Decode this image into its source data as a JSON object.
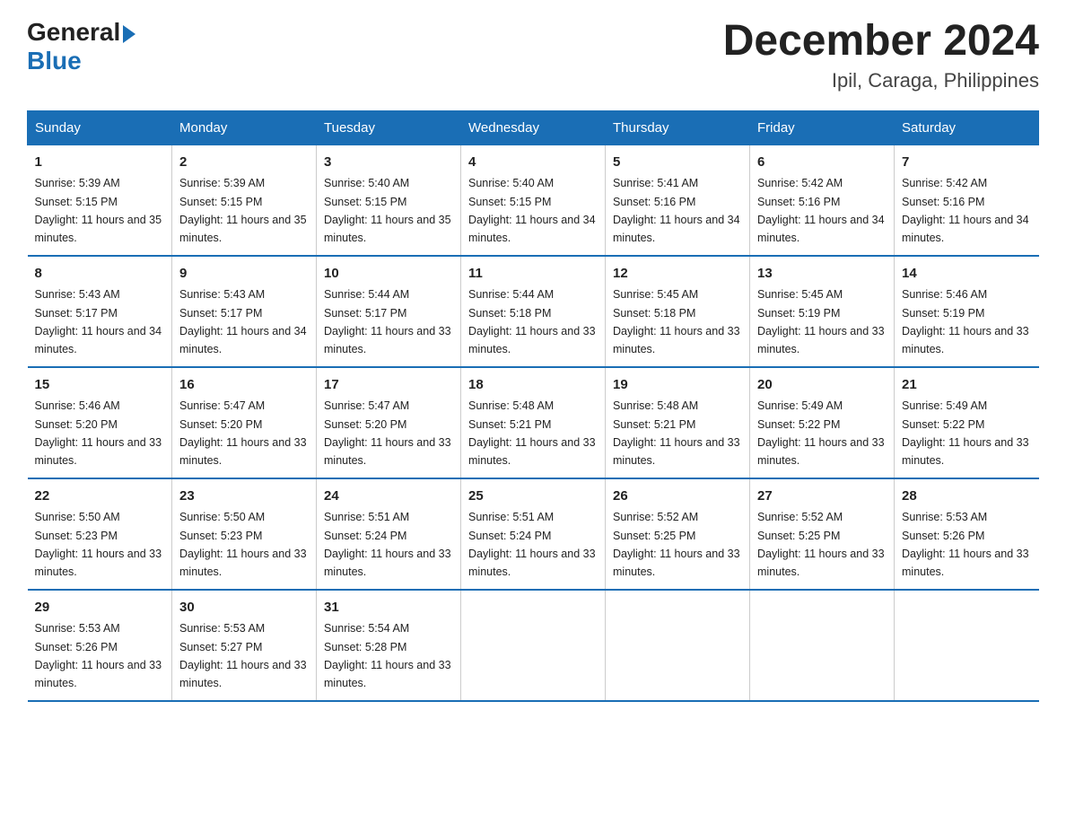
{
  "header": {
    "logo_general": "General",
    "logo_blue": "Blue",
    "title": "December 2024",
    "subtitle": "Ipil, Caraga, Philippines"
  },
  "days_of_week": [
    "Sunday",
    "Monday",
    "Tuesday",
    "Wednesday",
    "Thursday",
    "Friday",
    "Saturday"
  ],
  "weeks": [
    [
      {
        "day": "1",
        "sunrise": "5:39 AM",
        "sunset": "5:15 PM",
        "daylight": "11 hours and 35 minutes."
      },
      {
        "day": "2",
        "sunrise": "5:39 AM",
        "sunset": "5:15 PM",
        "daylight": "11 hours and 35 minutes."
      },
      {
        "day": "3",
        "sunrise": "5:40 AM",
        "sunset": "5:15 PM",
        "daylight": "11 hours and 35 minutes."
      },
      {
        "day": "4",
        "sunrise": "5:40 AM",
        "sunset": "5:15 PM",
        "daylight": "11 hours and 34 minutes."
      },
      {
        "day": "5",
        "sunrise": "5:41 AM",
        "sunset": "5:16 PM",
        "daylight": "11 hours and 34 minutes."
      },
      {
        "day": "6",
        "sunrise": "5:42 AM",
        "sunset": "5:16 PM",
        "daylight": "11 hours and 34 minutes."
      },
      {
        "day": "7",
        "sunrise": "5:42 AM",
        "sunset": "5:16 PM",
        "daylight": "11 hours and 34 minutes."
      }
    ],
    [
      {
        "day": "8",
        "sunrise": "5:43 AM",
        "sunset": "5:17 PM",
        "daylight": "11 hours and 34 minutes."
      },
      {
        "day": "9",
        "sunrise": "5:43 AM",
        "sunset": "5:17 PM",
        "daylight": "11 hours and 34 minutes."
      },
      {
        "day": "10",
        "sunrise": "5:44 AM",
        "sunset": "5:17 PM",
        "daylight": "11 hours and 33 minutes."
      },
      {
        "day": "11",
        "sunrise": "5:44 AM",
        "sunset": "5:18 PM",
        "daylight": "11 hours and 33 minutes."
      },
      {
        "day": "12",
        "sunrise": "5:45 AM",
        "sunset": "5:18 PM",
        "daylight": "11 hours and 33 minutes."
      },
      {
        "day": "13",
        "sunrise": "5:45 AM",
        "sunset": "5:19 PM",
        "daylight": "11 hours and 33 minutes."
      },
      {
        "day": "14",
        "sunrise": "5:46 AM",
        "sunset": "5:19 PM",
        "daylight": "11 hours and 33 minutes."
      }
    ],
    [
      {
        "day": "15",
        "sunrise": "5:46 AM",
        "sunset": "5:20 PM",
        "daylight": "11 hours and 33 minutes."
      },
      {
        "day": "16",
        "sunrise": "5:47 AM",
        "sunset": "5:20 PM",
        "daylight": "11 hours and 33 minutes."
      },
      {
        "day": "17",
        "sunrise": "5:47 AM",
        "sunset": "5:20 PM",
        "daylight": "11 hours and 33 minutes."
      },
      {
        "day": "18",
        "sunrise": "5:48 AM",
        "sunset": "5:21 PM",
        "daylight": "11 hours and 33 minutes."
      },
      {
        "day": "19",
        "sunrise": "5:48 AM",
        "sunset": "5:21 PM",
        "daylight": "11 hours and 33 minutes."
      },
      {
        "day": "20",
        "sunrise": "5:49 AM",
        "sunset": "5:22 PM",
        "daylight": "11 hours and 33 minutes."
      },
      {
        "day": "21",
        "sunrise": "5:49 AM",
        "sunset": "5:22 PM",
        "daylight": "11 hours and 33 minutes."
      }
    ],
    [
      {
        "day": "22",
        "sunrise": "5:50 AM",
        "sunset": "5:23 PM",
        "daylight": "11 hours and 33 minutes."
      },
      {
        "day": "23",
        "sunrise": "5:50 AM",
        "sunset": "5:23 PM",
        "daylight": "11 hours and 33 minutes."
      },
      {
        "day": "24",
        "sunrise": "5:51 AM",
        "sunset": "5:24 PM",
        "daylight": "11 hours and 33 minutes."
      },
      {
        "day": "25",
        "sunrise": "5:51 AM",
        "sunset": "5:24 PM",
        "daylight": "11 hours and 33 minutes."
      },
      {
        "day": "26",
        "sunrise": "5:52 AM",
        "sunset": "5:25 PM",
        "daylight": "11 hours and 33 minutes."
      },
      {
        "day": "27",
        "sunrise": "5:52 AM",
        "sunset": "5:25 PM",
        "daylight": "11 hours and 33 minutes."
      },
      {
        "day": "28",
        "sunrise": "5:53 AM",
        "sunset": "5:26 PM",
        "daylight": "11 hours and 33 minutes."
      }
    ],
    [
      {
        "day": "29",
        "sunrise": "5:53 AM",
        "sunset": "5:26 PM",
        "daylight": "11 hours and 33 minutes."
      },
      {
        "day": "30",
        "sunrise": "5:53 AM",
        "sunset": "5:27 PM",
        "daylight": "11 hours and 33 minutes."
      },
      {
        "day": "31",
        "sunrise": "5:54 AM",
        "sunset": "5:28 PM",
        "daylight": "11 hours and 33 minutes."
      },
      null,
      null,
      null,
      null
    ]
  ]
}
